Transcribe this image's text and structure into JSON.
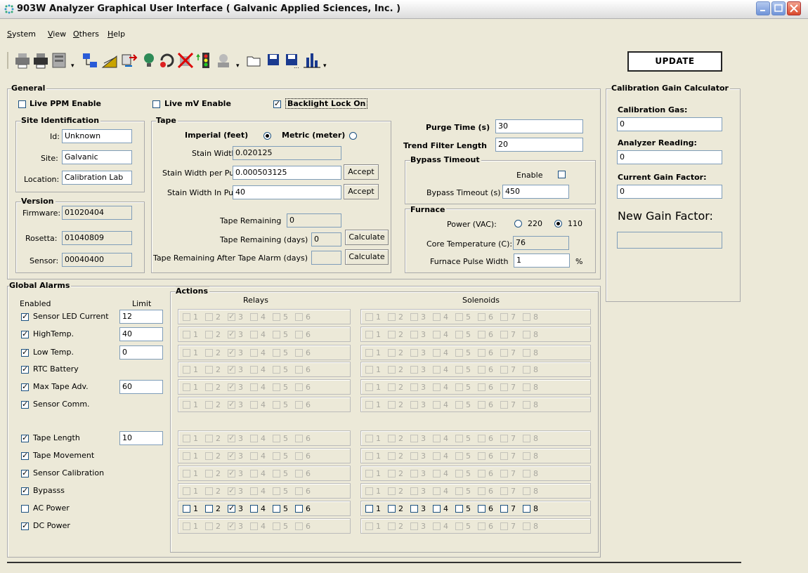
{
  "window": {
    "title": "903W Analyzer Graphical User Interface  ( Galvanic Applied Sciences, Inc. )"
  },
  "menu": [
    "System",
    "View",
    "Others",
    "Help"
  ],
  "toolbar": {
    "update_label": "UPDATE"
  },
  "general": {
    "title": "General",
    "live_ppm_label": "Live PPM Enable",
    "live_mv_label": "Live mV Enable",
    "backlight_label": "Backlight Lock On"
  },
  "site": {
    "title": "Site Identification",
    "id_label": "Id:",
    "id_value": "Unknown",
    "site_label": "Site:",
    "site_value": "Galvanic",
    "location_label": "Location:",
    "location_value": "Calibration Lab"
  },
  "version": {
    "title": "Version",
    "firmware_label": "Firmware:",
    "firmware_value": "01020404",
    "rosetta_label": "Rosetta:",
    "rosetta_value": "01040809",
    "sensor_label": "Sensor:",
    "sensor_value": "00040400"
  },
  "tape": {
    "title": "Tape",
    "imperial_label": "Imperial (feet)",
    "metric_label": "Metric (meter)",
    "stain_width_label": "Stain Width",
    "stain_width_value": "0.020125",
    "per_pulse_label": "Stain Width per Pulse",
    "per_pulse_value": "0.000503125",
    "in_pulses_label": "Stain Width In Pulses",
    "in_pulses_value": "40",
    "accept_label": "Accept",
    "remaining_label": "Tape Remaining",
    "remaining_value": "0",
    "remaining_days_label": "Tape Remaining (days)",
    "remaining_days_value": "0",
    "after_alarm_label": "Tape Remaining After Tape Alarm (days)",
    "after_alarm_value": "",
    "calculate_label": "Calculate"
  },
  "purge": {
    "label": "Purge Time (s)",
    "value": "30"
  },
  "trend": {
    "label": "Trend Filter Length",
    "value": "20"
  },
  "bypass": {
    "title": "Bypass Timeout",
    "enable_label": "Enable",
    "timeout_label": "Bypass Timeout (s)",
    "timeout_value": "450"
  },
  "furnace": {
    "title": "Furnace",
    "power_label": "Power (VAC):",
    "opt_220": "220",
    "opt_110": "110",
    "core_temp_label": "Core Temperature (C):",
    "core_temp_value": "76",
    "pulse_label": "Furnace Pulse Width",
    "pulse_value": "1",
    "pulse_unit": "%"
  },
  "calib": {
    "title": "Calibration Gain Calculator",
    "gas_label": "Calibration Gas:",
    "gas_value": "0",
    "reading_label": "Analyzer Reading:",
    "reading_value": "0",
    "factor_label": "Current Gain Factor:",
    "factor_value": "0",
    "new_label": "New Gain Factor:",
    "new_value": ""
  },
  "alarms": {
    "title": "Global Alarms",
    "enabled_header": "Enabled",
    "limit_header": "Limit",
    "actions_title": "Actions",
    "relays_header": "Relays",
    "solenoids_header": "Solenoids",
    "rows": [
      {
        "label": "Sensor LED Current",
        "checked": true,
        "limit": "12",
        "active": false
      },
      {
        "label": "HighTemp.",
        "checked": true,
        "limit": "40",
        "active": false
      },
      {
        "label": "Low Temp.",
        "checked": true,
        "limit": "0",
        "active": false
      },
      {
        "label": "RTC Battery",
        "checked": true,
        "limit": null,
        "active": false
      },
      {
        "label": "Max Tape Adv.",
        "checked": true,
        "limit": "60",
        "active": false
      },
      {
        "label": "Sensor Comm.",
        "checked": true,
        "limit": null,
        "active": false
      },
      {
        "label": "Tape Length",
        "checked": true,
        "limit": "10",
        "active": false
      },
      {
        "label": "Tape Movement",
        "checked": true,
        "limit": null,
        "active": false
      },
      {
        "label": "Sensor Calibration",
        "checked": true,
        "limit": null,
        "active": false
      },
      {
        "label": "Bypasss",
        "checked": true,
        "limit": null,
        "active": false
      },
      {
        "label": "AC Power",
        "checked": false,
        "limit": null,
        "active": true
      },
      {
        "label": "DC Power",
        "checked": true,
        "limit": null,
        "active": false
      }
    ],
    "relay_numbers": [
      "1",
      "2",
      "3",
      "4",
      "5",
      "6"
    ],
    "solenoid_numbers": [
      "1",
      "2",
      "3",
      "4",
      "5",
      "6",
      "7",
      "8"
    ]
  }
}
